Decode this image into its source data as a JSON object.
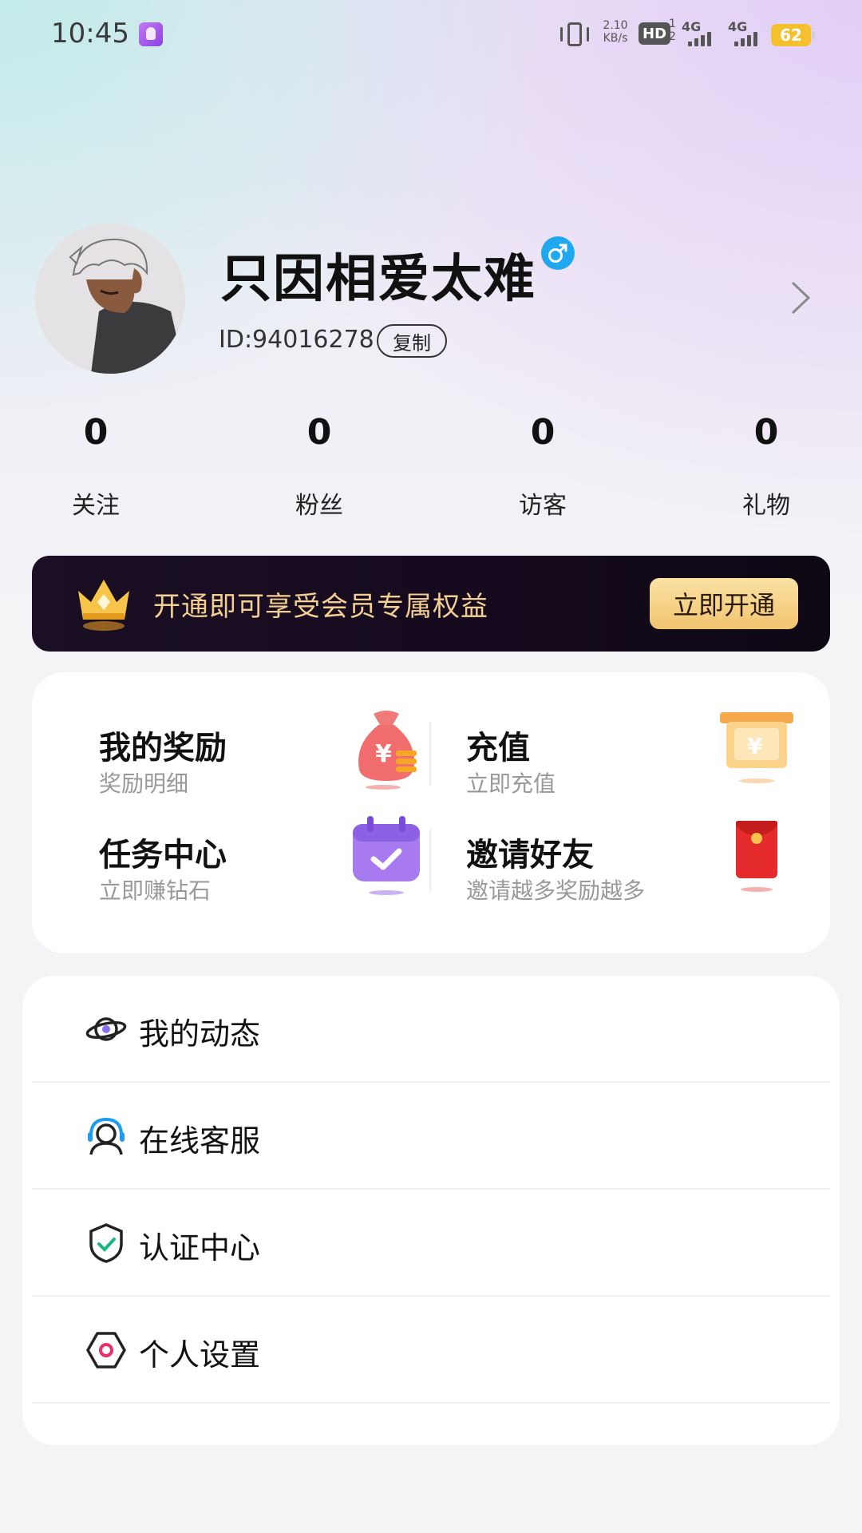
{
  "status_bar": {
    "time": "10:45",
    "net_speed_value": "2.10",
    "net_speed_unit": "KB/s",
    "hd_label": "HD",
    "hd_sim1": "1",
    "hd_sim2": "2",
    "signal1_label": "4G",
    "signal2_label": "4G",
    "battery_level": "62"
  },
  "profile": {
    "username": "只因相爱太难",
    "gender": "male",
    "user_id": "ID:94016278",
    "copy_label": "复制"
  },
  "stats": [
    {
      "value": "0",
      "label": "关注"
    },
    {
      "value": "0",
      "label": "粉丝"
    },
    {
      "value": "0",
      "label": "访客"
    },
    {
      "value": "0",
      "label": "礼物"
    }
  ],
  "vip_banner": {
    "text": "开通即可享受会员专属权益",
    "button_label": "立即开通"
  },
  "rewards": [
    {
      "title": "我的奖励",
      "subtitle": "奖励明细",
      "icon": "money-bag-icon"
    },
    {
      "title": "充值",
      "subtitle": "立即充值",
      "icon": "yuan-box-icon"
    },
    {
      "title": "任务中心",
      "subtitle": "立即赚钻石",
      "icon": "calendar-check-icon"
    },
    {
      "title": "邀请好友",
      "subtitle": "邀请越多奖励越多",
      "icon": "red-envelope-icon"
    }
  ],
  "menu": [
    {
      "label": "我的动态",
      "icon": "planet-icon"
    },
    {
      "label": "在线客服",
      "icon": "customer-service-icon"
    },
    {
      "label": "认证中心",
      "icon": "shield-check-icon"
    },
    {
      "label": "个人设置",
      "icon": "hexagon-settings-icon"
    }
  ],
  "colors": {
    "vip_text": "#f3cf91",
    "vip_button": "#f1c46f",
    "gender_badge": "#1fa8f0",
    "battery": "#f4c02e"
  }
}
